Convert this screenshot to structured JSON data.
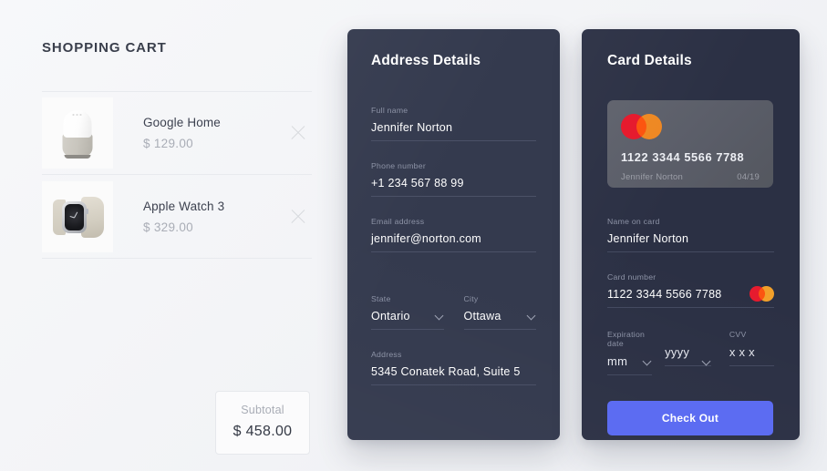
{
  "cart": {
    "title": "SHOPPING CART",
    "items": [
      {
        "name": "Google Home",
        "price": "$ 129.00",
        "thumb": "google-home-speaker",
        "remove": "remove-item-icon"
      },
      {
        "name": "Apple Watch 3",
        "price": "$ 329.00",
        "thumb": "apple-watch",
        "remove": "remove-item-icon"
      }
    ],
    "subtotal_label": "Subtotal",
    "subtotal_value": "$ 458.00"
  },
  "address_panel": {
    "title": "Address Details",
    "fields": {
      "full_name": {
        "label": "Full name",
        "value": "Jennifer Norton"
      },
      "phone": {
        "label": "Phone number",
        "value": "+1 234 567 88 99"
      },
      "email": {
        "label": "Email address",
        "value": "jennifer@norton.com"
      },
      "state": {
        "label": "State",
        "value": "Ontario",
        "chevron": "chevron-down-icon"
      },
      "city": {
        "label": "City",
        "value": "Ottawa",
        "chevron": "chevron-down-icon"
      },
      "address": {
        "label": "Address",
        "value": "5345 Conatek Road, Suite 5"
      }
    }
  },
  "card_panel": {
    "title": "Card Details",
    "credit_card": {
      "brand": "mastercard-logo",
      "number": "1122  3344  5566  7788",
      "holder": "Jennifer Norton",
      "expiry": "04/19"
    },
    "fields": {
      "name_on_card": {
        "label": "Name on card",
        "value": "Jennifer Norton"
      },
      "card_number": {
        "label": "Card number",
        "value": "1122  3344  5566  7788",
        "brand_icon": "mastercard-logo"
      },
      "expiration": {
        "label": "Expiration date",
        "month": "mm",
        "year": "yyyy",
        "chevron": "chevron-down-icon"
      },
      "cvv": {
        "label": "CVV",
        "value": "x x x"
      }
    },
    "checkout_label": "Check Out"
  },
  "colors": {
    "page_background": "#f4f5f8",
    "panel_address": "#343a4e",
    "panel_card": "#2b3044",
    "accent_button": "#5c6cf2",
    "credit_card": "#5a5d68",
    "mastercard_red": "#e61b2e",
    "mastercard_orange": "#f2a02a",
    "text_dark": "#3d4250",
    "text_muted": "#a9adb6",
    "label_muted": "#8d93a6"
  }
}
